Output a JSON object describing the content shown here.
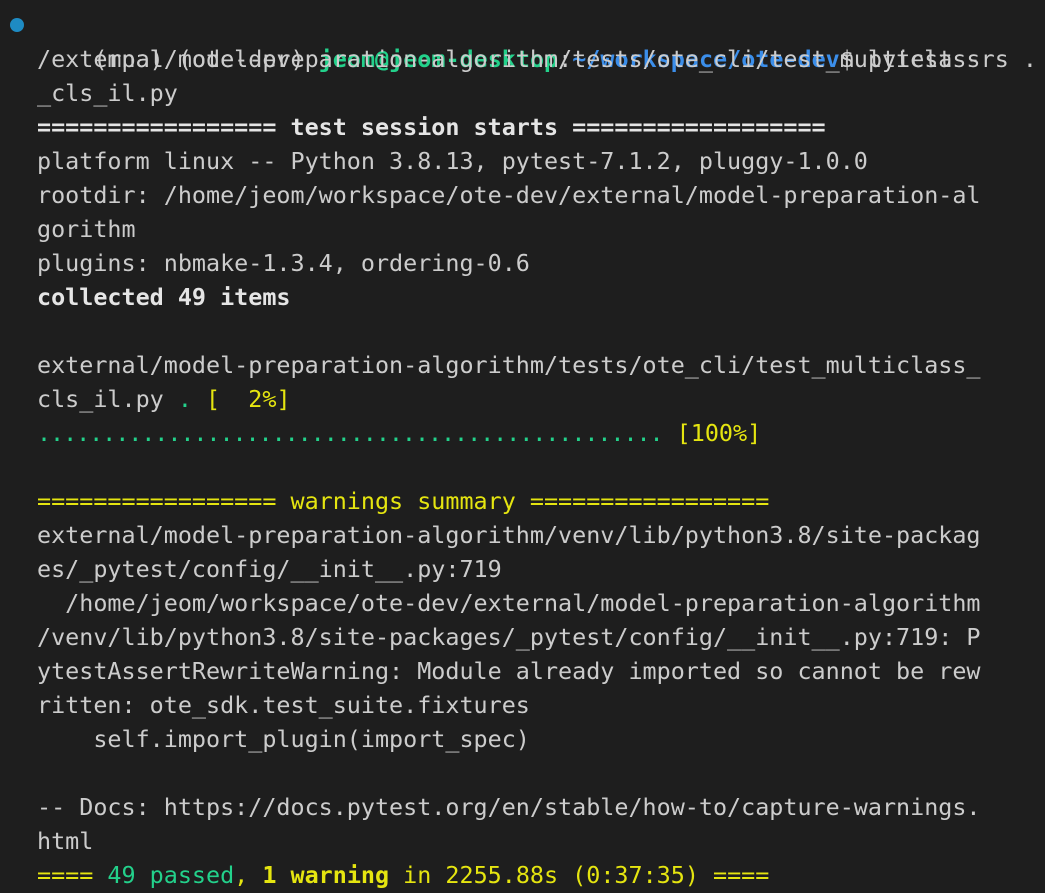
{
  "prompt": {
    "env1": "(mpa)",
    "env2": "(ote-dev)",
    "user_host": "jeom@jeom-desktop",
    "colon": ":",
    "path": "~/workspace/ote-dev",
    "dollar": "$",
    "command": "pytest -rs ."
  },
  "lines": {
    "cmd_cont_1": "/external/model-preparation-algorithm/tests/ote_cli/test_multiclass",
    "cmd_cont_2": "_cls_il.py",
    "session_header": "================= test session starts ==================",
    "platform": "platform linux -- Python 3.8.13, pytest-7.1.2, pluggy-1.0.0",
    "rootdir_1": "rootdir: /home/jeom/workspace/ote-dev/external/model-preparation-al",
    "rootdir_2": "gorithm",
    "plugins": "plugins: nbmake-1.3.4, ordering-0.6",
    "collected": "collected 49 items",
    "test_path_1": "external/model-preparation-algorithm/tests/ote_cli/test_multiclass_",
    "test_path_2": "cls_il.py",
    "test_progress_dot": ".",
    "test_progress_pct": "[  2%]",
    "progress_dots": "................................................",
    "progress_pct": "[100%]",
    "warnings_header": "================= warnings summary =================",
    "warn_1": "external/model-preparation-algorithm/venv/lib/python3.8/site-packag",
    "warn_2": "es/_pytest/config/__init__.py:719",
    "warn_3": "  /home/jeom/workspace/ote-dev/external/model-preparation-algorithm",
    "warn_4": "/venv/lib/python3.8/site-packages/_pytest/config/__init__.py:719: P",
    "warn_5": "ytestAssertRewriteWarning: Module already imported so cannot be rew",
    "warn_6": "ritten: ote_sdk.test_suite.fixtures",
    "warn_7": "    self.import_plugin(import_spec)",
    "docs_1": "-- Docs: https://docs.pytest.org/en/stable/how-to/capture-warnings.",
    "docs_2": "html"
  },
  "summary": {
    "left_bar": "==== ",
    "passed": "49 passed",
    "comma": ", ",
    "warning": "1 warning",
    "rest": " in 2255.88s (0:37:35) ",
    "right_bar": "===="
  },
  "colors": {
    "background": "#1e1e1e",
    "foreground": "#cccccc",
    "green": "#23d18b",
    "blue": "#3b8eea",
    "yellow": "#e5e510",
    "dot_indicator": "#1e8bc3"
  }
}
